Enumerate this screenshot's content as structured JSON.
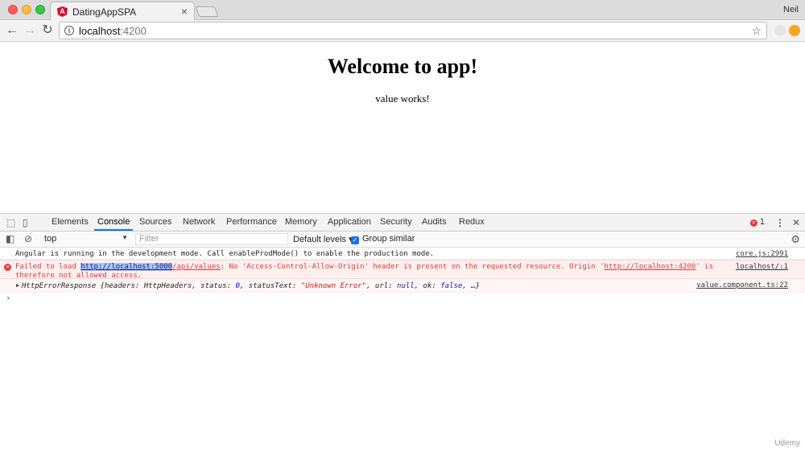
{
  "browser": {
    "tab_title": "DatingAppSPA",
    "tab_close": "×",
    "profile_name": "Neil",
    "url_host": "localhost",
    "url_port": ":4200"
  },
  "page": {
    "heading": "Welcome to app!",
    "paragraph": "value works!"
  },
  "devtools": {
    "tabs": [
      "Elements",
      "Console",
      "Sources",
      "Network",
      "Performance",
      "Memory",
      "Application",
      "Security",
      "Audits",
      "Redux"
    ],
    "active_tab": "Console",
    "error_count": "1",
    "context": "top",
    "filter_placeholder": "Filter",
    "levels_label": "Default levels ▾",
    "group_similar_label": "Group similar",
    "messages": {
      "info": {
        "text": "Angular is running in the development mode. Call enableProdMode() to enable the production mode.",
        "source": "core.js:2991"
      },
      "error": {
        "prefix": "Failed to load ",
        "url_selected": "http://localhost:5000",
        "url_rest": "/api/values",
        "middle": ": No 'Access-Control-Allow-Origin' header is present on the requested resource. Origin '",
        "origin_url": "http://localhost:4200",
        "suffix": "' is therefore not allowed access.",
        "source": "localhost/:1"
      },
      "object": {
        "name": "HttpErrorResponse ",
        "p1": "{headers: HttpHeaders, status: ",
        "status_val": "0",
        "p2": ", statusText: ",
        "status_text": "\"Unknown Error\"",
        "p3": ", url: ",
        "url_val": "null",
        "p4": ", ok: ",
        "ok_val": "false",
        "p5": ", …}",
        "source": "value.component.ts:22"
      }
    }
  },
  "watermark": "Udemy"
}
